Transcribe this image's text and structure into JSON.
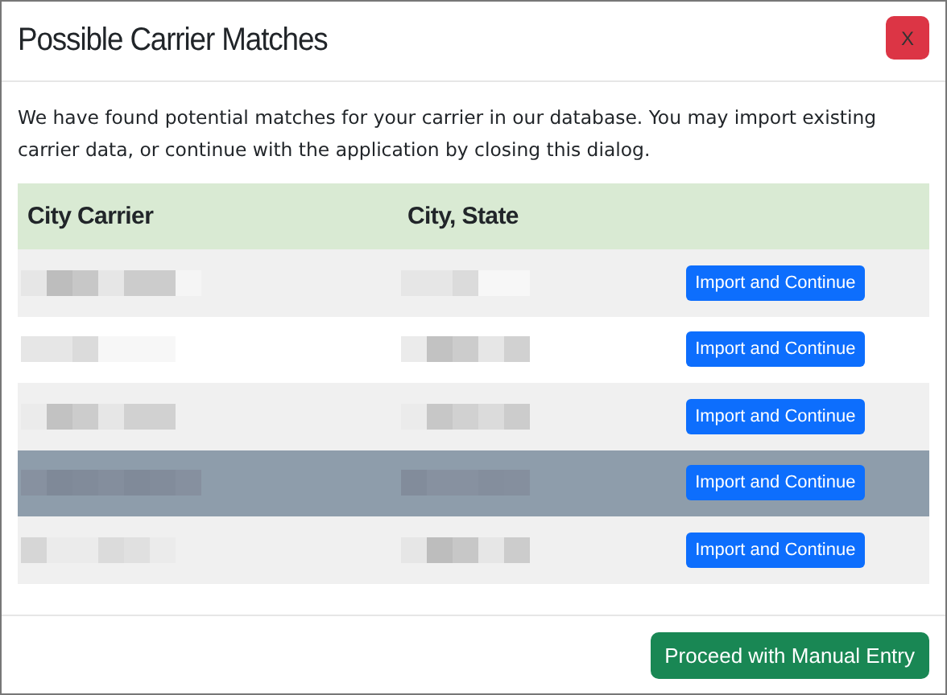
{
  "dialog": {
    "title": "Possible Carrier Matches",
    "close_label": "X",
    "message": "We have found potential matches for your carrier in our database. You may import existing carrier data, or continue with the application by closing this dialog.",
    "table": {
      "columns": [
        "City Carrier",
        "City, State"
      ],
      "rows": [
        {
          "selected": false,
          "action": "Import and Continue"
        },
        {
          "selected": false,
          "action": "Import and Continue"
        },
        {
          "selected": false,
          "action": "Import and Continue"
        },
        {
          "selected": true,
          "action": "Import and Continue"
        },
        {
          "selected": false,
          "action": "Import and Continue"
        }
      ]
    },
    "footer_button": "Proceed with Manual Entry"
  }
}
